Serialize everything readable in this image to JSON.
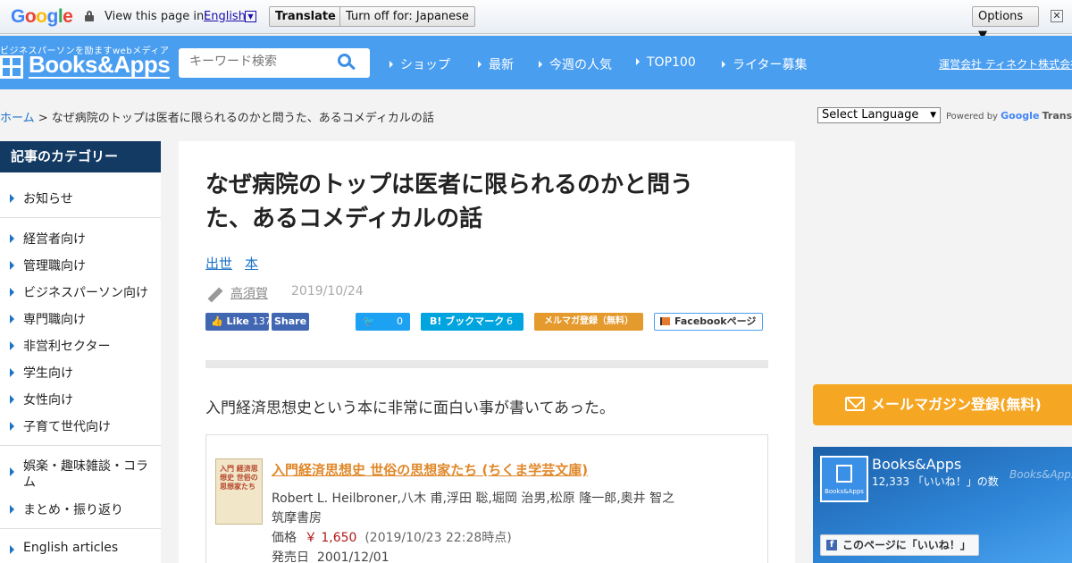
{
  "gtranslate": {
    "logo": [
      "G",
      "o",
      "o",
      "g",
      "l",
      "e"
    ],
    "logo_colors": [
      "#4285f4",
      "#ea4335",
      "#fbbc05",
      "#4285f4",
      "#34a853",
      "#ea4335"
    ],
    "view_text": "View this page in:",
    "language": "English",
    "translate_label": "Translate",
    "turnoff_label": "Turn off for: Japanese",
    "options_label": "Options ▼",
    "close_glyph": "✕"
  },
  "header": {
    "tagline": "ビジネスパーソンを励ますwebメディア",
    "logo_text": "Books&Apps",
    "search_placeholder": "キーワード検索",
    "nav": [
      {
        "label": "ショップ"
      },
      {
        "label": "最新"
      },
      {
        "label": "今週の人気"
      },
      {
        "label": "TOP100"
      },
      {
        "label": "ライター募集"
      }
    ],
    "company": "運営会社 ティネクト株式会社"
  },
  "breadcrumb": {
    "home": "ホーム",
    "separator": " > ",
    "current": "なぜ病院のトップは医者に限られるのかと問うた、あるコメディカルの話"
  },
  "translate_widget": {
    "select_label": "Select Language",
    "powered_by": "Powered by",
    "google": "Google",
    "translate": "Translate"
  },
  "sidebar": {
    "title": "記事のカテゴリー",
    "items": [
      {
        "label": "お知らせ"
      },
      {
        "label": "経営者向け"
      },
      {
        "label": "管理職向け"
      },
      {
        "label": "ビジネスパーソン向け"
      },
      {
        "label": "専門職向け"
      },
      {
        "label": "非営利セクター"
      },
      {
        "label": "学生向け"
      },
      {
        "label": "女性向け"
      },
      {
        "label": "子育て世代向け"
      },
      {
        "label": "娯楽・趣味雑談・コラム"
      },
      {
        "label": "まとめ・振り返り"
      },
      {
        "label": "English articles"
      }
    ]
  },
  "article": {
    "title_line1": "なぜ病院のトップは医者に限られるのかと問う",
    "title_line2": "た、あるコメディカルの話",
    "tags": [
      "出世",
      "本"
    ],
    "author": "高須賀",
    "date": "2019/10/24",
    "share": {
      "fb_like": "Like",
      "fb_like_count": "137",
      "fb_share": "Share",
      "twitter_count": "0",
      "hatena": "B! ブックマーク",
      "hatena_count": "6",
      "mailmag": "メルマガ登録（無料）",
      "fb_page": "Facebookページ"
    },
    "lead": "入門経済思想史という本に非常に面白い事が書いてあった。",
    "book": {
      "cover_text": "入門 経済思想史 世俗の 思想家たち",
      "title": "入門経済思想史 世俗の思想家たち (ちくま学芸文庫)",
      "authors": "Robert L. Heilbroner,八木 甫,浮田 聡,堀岡 治男,松原 隆一郎,奥井 智之",
      "publisher": "筑摩書房",
      "price_label": "価格",
      "price": "￥ 1,650",
      "price_time": "(2019/10/23 22:28時点)",
      "release_label": "発売日",
      "release": "2001/12/01"
    }
  },
  "right": {
    "mag_button": "メールマガジン登録(無料)",
    "fb_name": "Books&Apps",
    "fb_count": "12,333 「いいね！」の数",
    "fb_watermark": "Books&Apps",
    "fb_avatar_label": "Books&Apps",
    "fb_like_page": "このページに「いいね！」"
  }
}
